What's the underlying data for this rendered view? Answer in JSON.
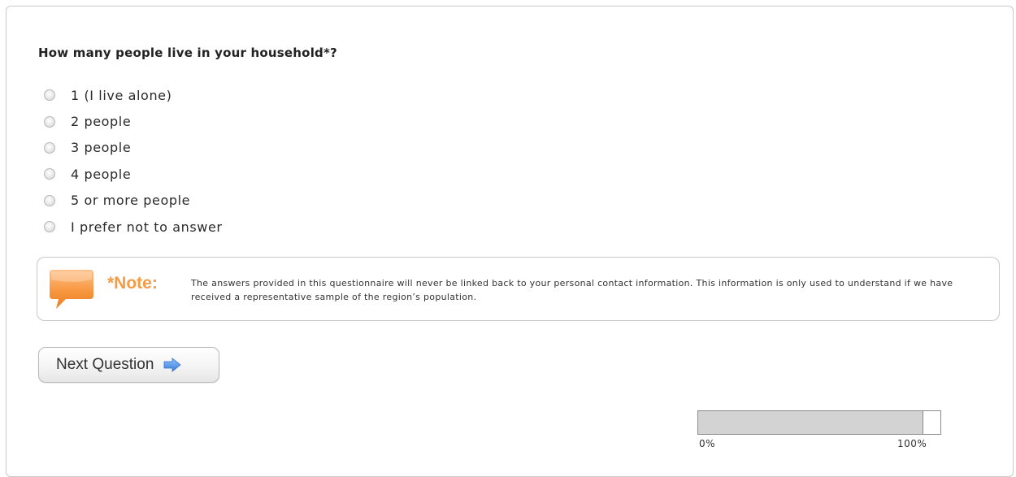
{
  "question": {
    "text": "How many people live in your household*?"
  },
  "options": [
    {
      "label": "1 (I live alone)",
      "selected": false
    },
    {
      "label": "2 people",
      "selected": false
    },
    {
      "label": "3 people",
      "selected": false
    },
    {
      "label": "4 people",
      "selected": false
    },
    {
      "label": "5 or more people",
      "selected": false
    },
    {
      "label": "I prefer not to answer",
      "selected": false
    }
  ],
  "note": {
    "icon": "speech-bubble-icon",
    "heading": "*Note:",
    "text": "The answers provided in this questionnaire will never be linked back to your personal contact information. This information is only used to understand if we have received a representative sample of the region’s population."
  },
  "next_button": {
    "label": "Next Question",
    "icon": "arrow-right-icon"
  },
  "progress": {
    "percent": 93,
    "min_label": "0%",
    "max_label": "100%"
  },
  "colors": {
    "note_accent": "#f59a45",
    "arrow": "#4a8ee0",
    "progress_fill": "#d3d3d3"
  }
}
